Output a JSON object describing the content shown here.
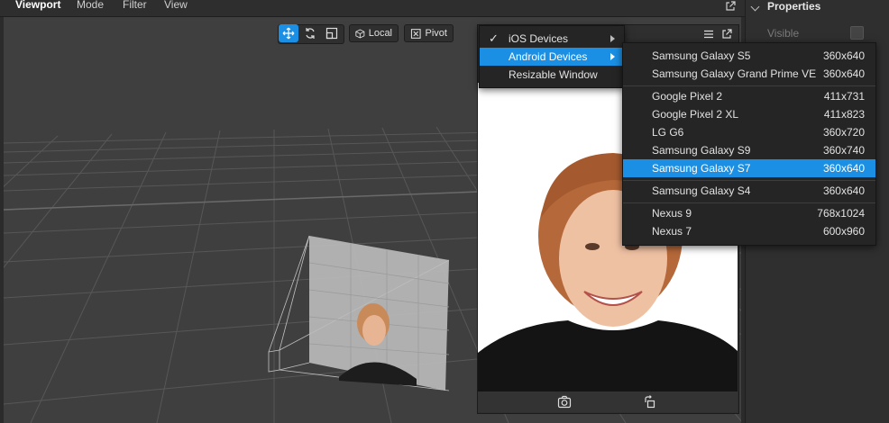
{
  "topbar": {
    "tabs": [
      "Viewport",
      "Mode",
      "Filter",
      "View"
    ]
  },
  "toolbar": {
    "local_label": "Local",
    "pivot_label": "Pivot"
  },
  "right_panel": {
    "title": "Properties",
    "visible_label": "Visible"
  },
  "main_menu": {
    "items": [
      {
        "label": "iOS Devices",
        "checked": true,
        "has_submenu": true
      },
      {
        "label": "Android Devices",
        "checked": false,
        "has_submenu": true,
        "highlighted": true
      },
      {
        "label": "Resizable Window",
        "checked": false,
        "has_submenu": false
      }
    ]
  },
  "android_menu": {
    "items": [
      {
        "name": "Samsung Galaxy S5",
        "res": "360x640"
      },
      {
        "name": "Samsung Galaxy Grand Prime VE",
        "res": "360x640"
      },
      {
        "name": "Google Pixel 2",
        "res": "411x731"
      },
      {
        "name": "Google Pixel 2 XL",
        "res": "411x823"
      },
      {
        "name": "LG G6",
        "res": "360x720"
      },
      {
        "name": "Samsung Galaxy S9",
        "res": "360x740"
      },
      {
        "name": "Samsung Galaxy S7",
        "res": "360x640",
        "highlighted": true
      },
      {
        "name": "Samsung Galaxy S4",
        "res": "360x640"
      },
      {
        "name": "Nexus 9",
        "res": "768x1024"
      },
      {
        "name": "Nexus 7",
        "res": "600x960"
      }
    ]
  },
  "colors": {
    "accent": "#1a8fe3",
    "viewport_bg": "#3f3f3f",
    "menu_bg": "#252525"
  }
}
